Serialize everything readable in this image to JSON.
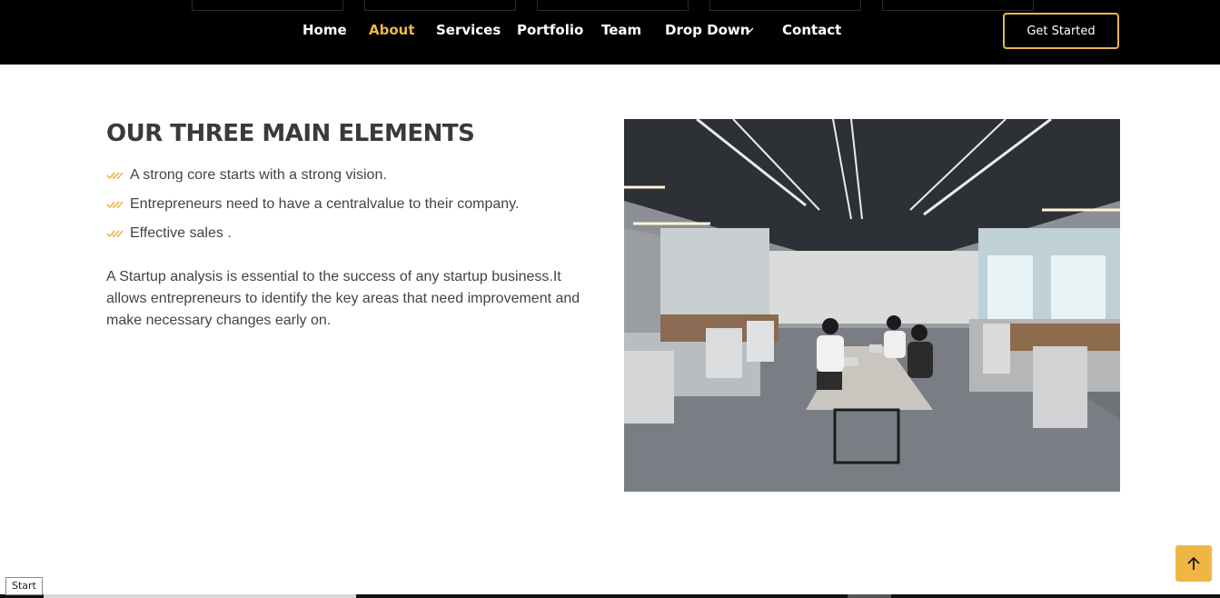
{
  "nav": {
    "items": [
      "Home",
      "About",
      "Services",
      "Portfolio",
      "Team",
      "Drop Down",
      "Contact"
    ],
    "active": "About",
    "cta_label": "Get Started"
  },
  "section": {
    "title": "OUR THREE MAIN ELEMENTS",
    "points": [
      "A strong core starts with a strong vision.",
      "Entrepreneurs need to have a centralvalue to their company.",
      "Effective sales ."
    ],
    "paragraph": "A Startup analysis is essential to the success of any startup business.It allows entrepreneurs to identify the key areas that need improvement and make necessary changes early on."
  },
  "tooltip": "Start",
  "colors": {
    "accent": "#e9b64d",
    "header_bg": "#000000",
    "back_to_top": "#f0b645"
  },
  "icons": {
    "chevron": "chevron-down-icon",
    "bullet": "double-check-icon",
    "back_to_top": "arrow-up-icon"
  }
}
